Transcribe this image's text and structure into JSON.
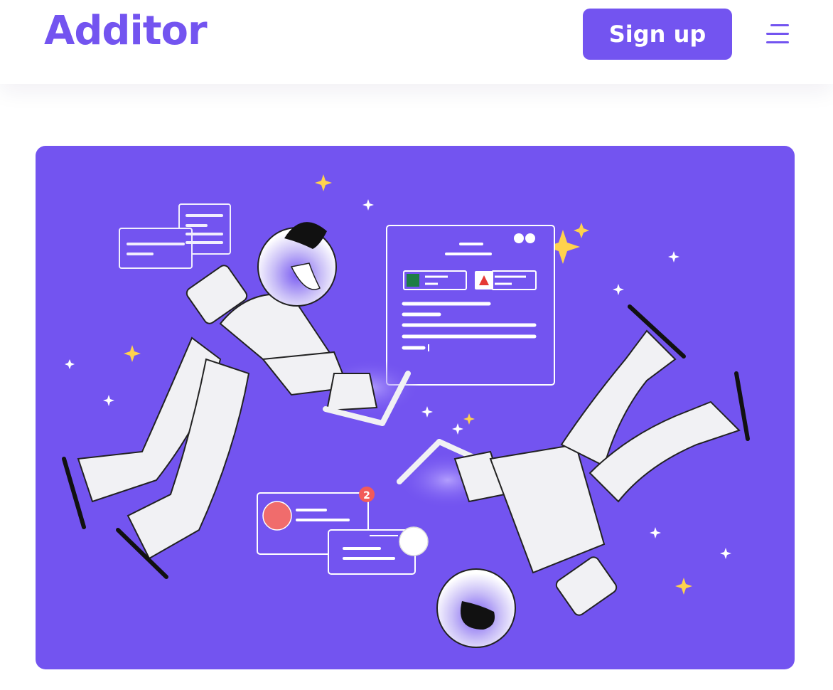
{
  "header": {
    "logo_text": "Additor",
    "signup_label": "Sign up",
    "menu_icon": "hamburger-menu-icon"
  },
  "hero": {
    "illustration": "two-astronauts-collaborating",
    "notification_count": "2",
    "colors": {
      "background": "#7354f0",
      "accent": "#7354f0",
      "star": "#ffd24d"
    }
  }
}
